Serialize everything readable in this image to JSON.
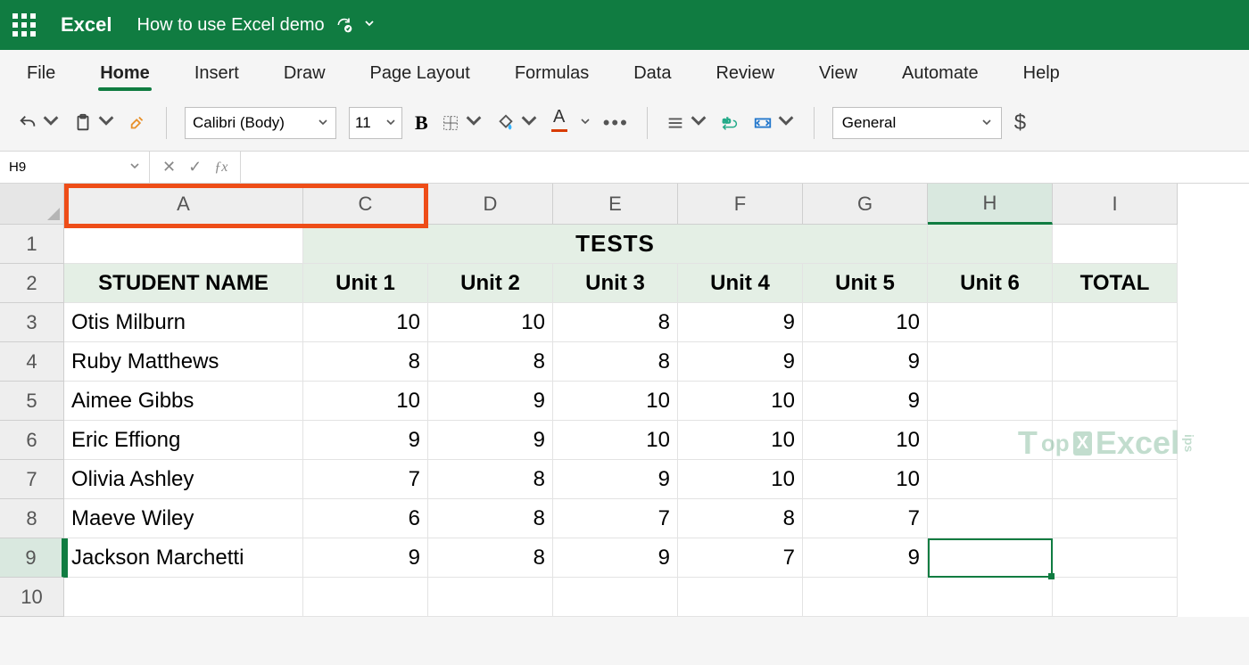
{
  "app": {
    "name": "Excel"
  },
  "document": {
    "title": "How to use Excel demo"
  },
  "ribbon": {
    "tabs": [
      "File",
      "Home",
      "Insert",
      "Draw",
      "Page Layout",
      "Formulas",
      "Data",
      "Review",
      "View",
      "Automate",
      "Help"
    ],
    "active_tab": "Home",
    "font_family": "Calibri (Body)",
    "font_size": "11",
    "number_format": "General"
  },
  "name_box": "H9",
  "formula_bar": "",
  "columns_visible": [
    "A",
    "C",
    "D",
    "E",
    "F",
    "G",
    "H",
    "I"
  ],
  "selected_column": "H",
  "selected_row": 9,
  "selected_cell": "H9",
  "highlight_columns": [
    "A",
    "C"
  ],
  "watermark_text": "TopExcelTips",
  "sheet": {
    "tests_title": "TESTS",
    "headers": {
      "student_name": "STUDENT NAME",
      "unit1": "Unit 1",
      "unit2": "Unit 2",
      "unit3": "Unit 3",
      "unit4": "Unit 4",
      "unit5": "Unit 5",
      "unit6": "Unit 6",
      "total": "TOTAL"
    },
    "rows": [
      {
        "name": "Otis Milburn",
        "u1": "10",
        "u2": "10",
        "u3": "8",
        "u4": "9",
        "u5": "10",
        "u6": "",
        "total": ""
      },
      {
        "name": "Ruby Matthews",
        "u1": "8",
        "u2": "8",
        "u3": "8",
        "u4": "9",
        "u5": "9",
        "u6": "",
        "total": ""
      },
      {
        "name": "Aimee Gibbs",
        "u1": "10",
        "u2": "9",
        "u3": "10",
        "u4": "10",
        "u5": "9",
        "u6": "",
        "total": ""
      },
      {
        "name": "Eric Effiong",
        "u1": "9",
        "u2": "9",
        "u3": "10",
        "u4": "10",
        "u5": "10",
        "u6": "",
        "total": ""
      },
      {
        "name": "Olivia Ashley",
        "u1": "7",
        "u2": "8",
        "u3": "9",
        "u4": "10",
        "u5": "10",
        "u6": "",
        "total": ""
      },
      {
        "name": "Maeve Wiley",
        "u1": "6",
        "u2": "8",
        "u3": "7",
        "u4": "8",
        "u5": "7",
        "u6": "",
        "total": ""
      },
      {
        "name": "Jackson Marchetti",
        "u1": "9",
        "u2": "8",
        "u3": "9",
        "u4": "7",
        "u5": "9",
        "u6": "",
        "total": ""
      }
    ]
  },
  "chart_data": {
    "type": "table",
    "title": "TESTS",
    "columns": [
      "STUDENT NAME",
      "Unit 1",
      "Unit 2",
      "Unit 3",
      "Unit 4",
      "Unit 5",
      "Unit 6",
      "TOTAL"
    ],
    "rows": [
      [
        "Otis Milburn",
        10,
        10,
        8,
        9,
        10,
        null,
        null
      ],
      [
        "Ruby Matthews",
        8,
        8,
        8,
        9,
        9,
        null,
        null
      ],
      [
        "Aimee Gibbs",
        10,
        9,
        10,
        10,
        9,
        null,
        null
      ],
      [
        "Eric Effiong",
        9,
        9,
        10,
        10,
        10,
        null,
        null
      ],
      [
        "Olivia Ashley",
        7,
        8,
        9,
        10,
        10,
        null,
        null
      ],
      [
        "Maeve Wiley",
        6,
        8,
        7,
        8,
        7,
        null,
        null
      ],
      [
        "Jackson Marchetti",
        9,
        8,
        9,
        7,
        9,
        null,
        null
      ]
    ]
  }
}
